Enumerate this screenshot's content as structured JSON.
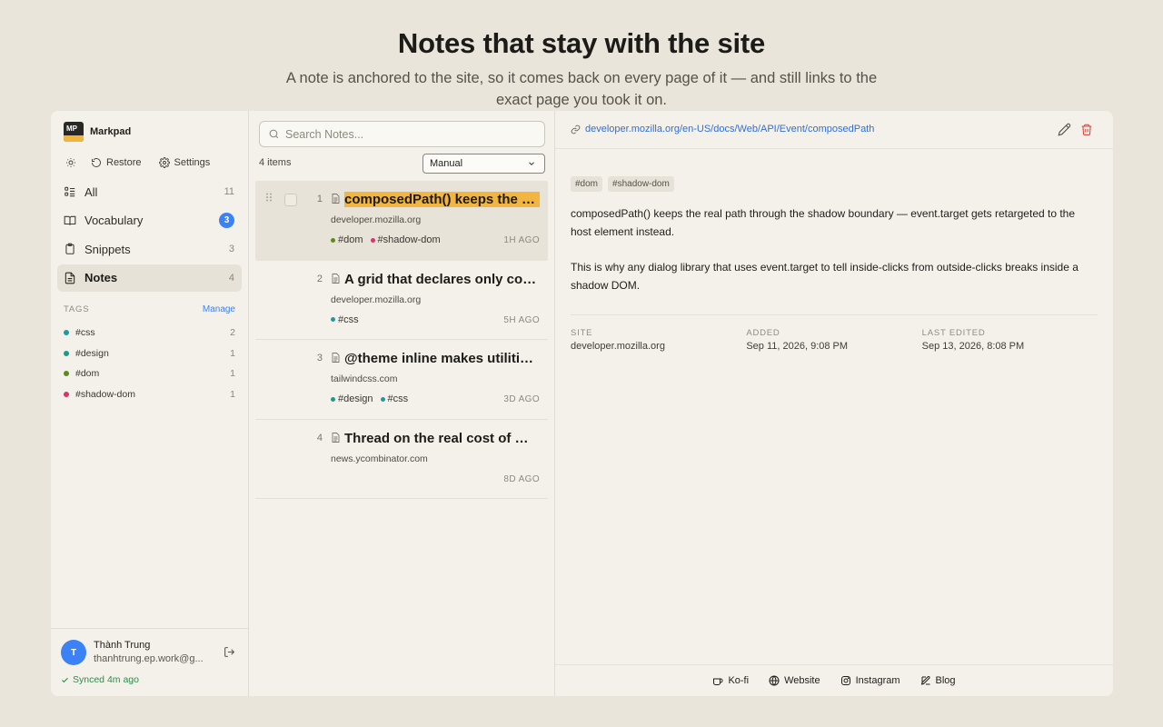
{
  "hero": {
    "title": "Notes that stay with the site",
    "subtitle": "A note is anchored to the site, so it comes back on every page of it — and still links to the exact page you took it on."
  },
  "app": {
    "name": "Markpad",
    "logo_text": "MP",
    "toolbar": {
      "restore": "Restore",
      "settings": "Settings"
    },
    "nav": [
      {
        "label": "All",
        "count": "11",
        "icon": "all-list-icon"
      },
      {
        "label": "Vocabulary",
        "count": "3",
        "icon": "book-icon",
        "badge": true
      },
      {
        "label": "Snippets",
        "count": "3",
        "icon": "clipboard-icon"
      },
      {
        "label": "Notes",
        "count": "4",
        "icon": "note-icon",
        "active": true
      }
    ],
    "tags_heading": "TAGS",
    "manage": "Manage",
    "tags": [
      {
        "name": "#css",
        "count": "2",
        "color": "#1f9aa0"
      },
      {
        "name": "#design",
        "count": "1",
        "color": "#1f9a8a"
      },
      {
        "name": "#dom",
        "count": "1",
        "color": "#5d8a1e"
      },
      {
        "name": "#shadow-dom",
        "count": "1",
        "color": "#d9336b"
      }
    ],
    "user": {
      "initial": "T",
      "name": "Thành Trung",
      "email": "thanhtrung.ep.work@gmail.com",
      "synced": "Synced 4m ago"
    }
  },
  "list": {
    "search_placeholder": "Search Notes...",
    "items_count": "4 items",
    "sort_value": "Manual",
    "notes": [
      {
        "num": "1",
        "title": "composedPath() keeps the real path through the shadow boundary",
        "domain": "developer.mozilla.org",
        "tags": [
          {
            "name": "#dom",
            "color": "#5d8a1e"
          },
          {
            "name": "#shadow-dom",
            "color": "#d9336b"
          }
        ],
        "age": "1H AGO",
        "selected": true
      },
      {
        "num": "2",
        "title": "A grid that declares only columns",
        "domain": "developer.mozilla.org",
        "tags": [
          {
            "name": "#css",
            "color": "#1f9aa0"
          }
        ],
        "age": "5H AGO"
      },
      {
        "num": "3",
        "title": "@theme inline makes utilities reference variables",
        "domain": "tailwindcss.com",
        "tags": [
          {
            "name": "#design",
            "color": "#1f9a8a"
          },
          {
            "name": "#css",
            "color": "#1f9aa0"
          }
        ],
        "age": "3D AGO"
      },
      {
        "num": "4",
        "title": "Thread on the real cost of microservices",
        "domain": "news.ycombinator.com",
        "tags": [],
        "age": "8D AGO"
      }
    ]
  },
  "detail": {
    "url": "developer.mozilla.org/en-US/docs/Web/API/Event/composedPath",
    "chips": [
      "#dom",
      "#shadow-dom"
    ],
    "paragraphs": [
      "composedPath() keeps the real path through the shadow boundary — event.target gets retargeted to the host element instead.",
      "This is why any dialog library that uses event.target to tell inside-clicks from outside-clicks breaks inside a shadow DOM."
    ],
    "meta": [
      {
        "key": "SITE",
        "value": "developer.mozilla.org"
      },
      {
        "key": "ADDED",
        "value": "Sep 11, 2026, 9:08 PM"
      },
      {
        "key": "LAST EDITED",
        "value": "Sep 13, 2026, 8:08 PM"
      }
    ]
  },
  "footer": [
    {
      "label": "Ko-fi",
      "icon": "coffee-icon"
    },
    {
      "label": "Website",
      "icon": "globe-icon"
    },
    {
      "label": "Instagram",
      "icon": "instagram-icon"
    },
    {
      "label": "Blog",
      "icon": "edit-icon"
    }
  ]
}
